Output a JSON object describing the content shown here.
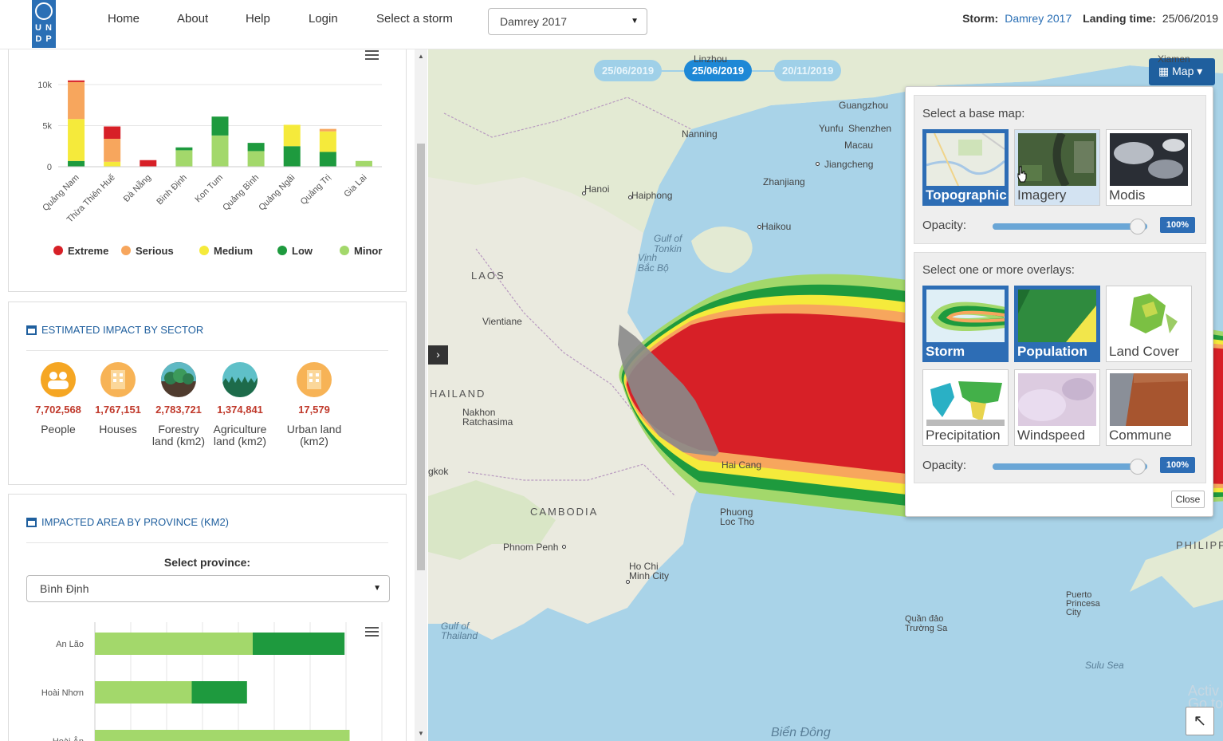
{
  "nav": {
    "logo_letters": "U N\nD P",
    "links": [
      "Home",
      "About",
      "Help",
      "Login",
      "Select a storm"
    ],
    "storm_select_value": "Damrey 2017",
    "storm_label": "Storm:",
    "storm_value": "Damrey 2017",
    "landing_label": "Landing time:",
    "landing_value": "25/06/2019"
  },
  "damage_chart": {
    "chart_data": {
      "type": "bar",
      "stacked": true,
      "categories": [
        "Quảng Nam",
        "Thừa Thiên Huế",
        "Đà Nẵng",
        "Bình Định",
        "Kon Tum",
        "Quảng Bình",
        "Quảng Ngãi",
        "Quảng Trị",
        "Gia Lai"
      ],
      "ylim": [
        0,
        10000
      ],
      "yticks": [
        "0",
        "5k",
        "10k"
      ],
      "series": [
        {
          "name": "Minor",
          "color": "#a3d86b",
          "values": [
            0,
            0,
            0,
            2000,
            3800,
            1900,
            0,
            0,
            700
          ]
        },
        {
          "name": "Low",
          "color": "#1e9a3e",
          "values": [
            700,
            0,
            0,
            350,
            2300,
            1000,
            2500,
            1800,
            0
          ]
        },
        {
          "name": "Medium",
          "color": "#f5ea3b",
          "values": [
            5100,
            600,
            0,
            0,
            0,
            0,
            2600,
            2500,
            0
          ]
        },
        {
          "name": "Serious",
          "color": "#f7a65d",
          "values": [
            4500,
            2800,
            0,
            0,
            0,
            0,
            0,
            300,
            0
          ]
        },
        {
          "name": "Extreme",
          "color": "#d72027",
          "values": [
            200,
            1500,
            800,
            0,
            0,
            0,
            0,
            0,
            0
          ]
        }
      ],
      "legend": [
        "Extreme",
        "Serious",
        "Medium",
        "Low",
        "Minor"
      ],
      "legend_position": "bottom"
    }
  },
  "sector": {
    "title": "ESTIMATED IMPACT BY SECTOR",
    "items": [
      {
        "value": "7,702,568",
        "label": "People"
      },
      {
        "value": "1,767,151",
        "label": "Houses"
      },
      {
        "value": "2,783,721",
        "label": "Forestry land (km2)"
      },
      {
        "value": "1,374,841",
        "label": "Agriculture land (km2)"
      },
      {
        "value": "17,579",
        "label": "Urban land (km2)"
      }
    ]
  },
  "province": {
    "title": "IMPACTED AREA BY PROVINCE (KM2)",
    "select_label": "Select province:",
    "select_value": "Bình Định",
    "chart_data": {
      "type": "bar",
      "orientation": "horizontal",
      "stacked": true,
      "categories": [
        "An Lão",
        "Hoài Nhơn",
        "Hoài Ân"
      ],
      "series": [
        {
          "name": "Minor",
          "color": "#a3d86b",
          "values": [
            220,
            135,
            355
          ]
        },
        {
          "name": "Low",
          "color": "#1e9a3e",
          "values": [
            128,
            77,
            0
          ]
        }
      ],
      "xlim": [
        0,
        400
      ]
    }
  },
  "map": {
    "dates": [
      "25/06/2019",
      "25/06/2019",
      "20/11/2019"
    ],
    "active_date_index": 1,
    "map_button": "Map",
    "labels": {
      "xiamen": "Xiamen",
      "linzhou": "Linzhou",
      "guangzhou": "Guangzhou",
      "yunfu": "Yunfu",
      "shenzhen": "Shenzhen",
      "macau": "Macau",
      "jiangcheng": "Jiangcheng",
      "nanning": "Nanning",
      "hanoi": "Hanoi",
      "haiphong": "Haiphong",
      "zhanjiang": "Zhanjiang",
      "haikou": "Haikou",
      "gulf_tonkin": "Gulf of\nTonkin",
      "vinh_bac_bo": "Vịnh\nBắc Bộ",
      "laos": "LAOS",
      "vientiane": "Vientiane",
      "thailand": "HAILAND",
      "nakhon": "Nakhon\nRatchasima",
      "bangkok": "gkok",
      "cambodia": "CAMBODIA",
      "phnom_penh": "Phnom Penh",
      "hcmc": "Ho Chi\nMinh City",
      "gulf_thailand": "Gulf of\nThailand",
      "phuong": "Phuong\nLoc Tho",
      "hai_cang": "Hai Cang",
      "quan_dao": "Quần đảo\nTrường Sa",
      "puerto": "Puerto\nPrincesa\nCity",
      "sulu": "Sulu Sea",
      "philip": "PHILIPP",
      "bien_dong": "Biển Đông",
      "activate": "Activ\nGo to"
    },
    "storm_band_colors": [
      "#a3d86b",
      "#1e9a3e",
      "#f5ea3b",
      "#f7a65d",
      "#d72027"
    ]
  },
  "layers": {
    "base_heading": "Select a base map:",
    "base_maps": [
      {
        "label": "Topographic",
        "selected": true
      },
      {
        "label": "Imagery",
        "selected": false
      },
      {
        "label": "Modis",
        "selected": false
      }
    ],
    "opacity_label": "Opacity:",
    "base_opacity": "100%",
    "base_opacity_level": 1.0,
    "overlay_heading": "Select one or more overlays:",
    "overlays": [
      {
        "label": "Storm",
        "selected": true
      },
      {
        "label": "Population",
        "selected": true
      },
      {
        "label": "Land Cover",
        "selected": false
      },
      {
        "label": "Precipitation",
        "selected": false
      },
      {
        "label": "Windspeed",
        "selected": false
      },
      {
        "label": "Commune",
        "selected": false
      }
    ],
    "overlay_opacity": "100%",
    "overlay_opacity_level": 1.0,
    "close_label": "Close"
  }
}
